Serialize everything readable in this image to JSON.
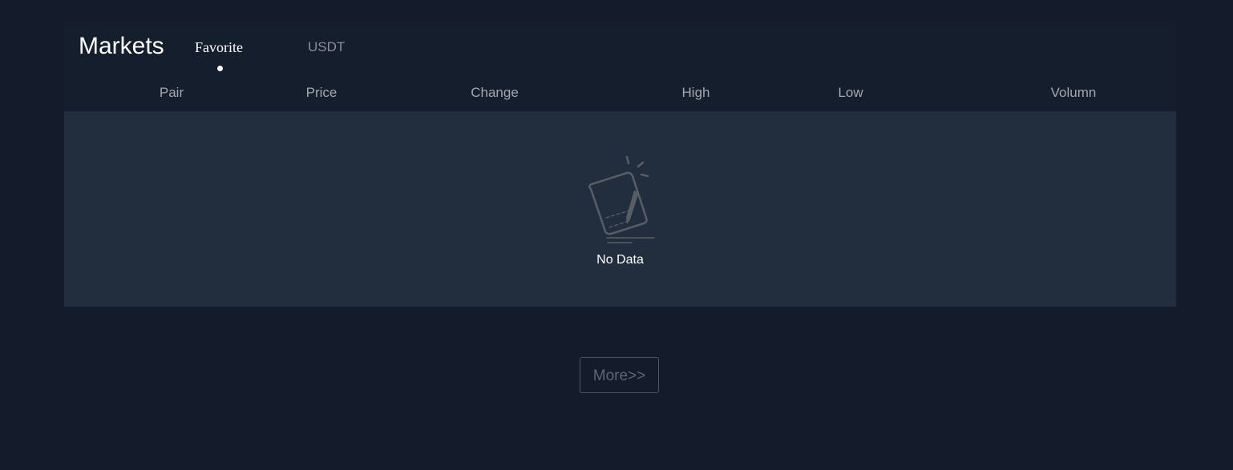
{
  "markets": {
    "title": "Markets",
    "tabs": [
      {
        "label": "Favorite",
        "active": true
      },
      {
        "label": "USDT",
        "active": false
      }
    ]
  },
  "table": {
    "columns": [
      "Pair",
      "Price",
      "Change",
      "High",
      "Low",
      "Volumn"
    ],
    "rows": [],
    "empty_text": "No Data",
    "empty_icon": "no-data-icon"
  },
  "more_label": "More>>",
  "colors": {
    "page_background": "#141c2b",
    "panel_background": "#151e2d",
    "table_body_background": "#222d3e",
    "active_tab": "#ffffff",
    "inactive_tab": "#8a8f99",
    "header_text": "#a3a7af",
    "icon_stroke": "#595e66"
  }
}
